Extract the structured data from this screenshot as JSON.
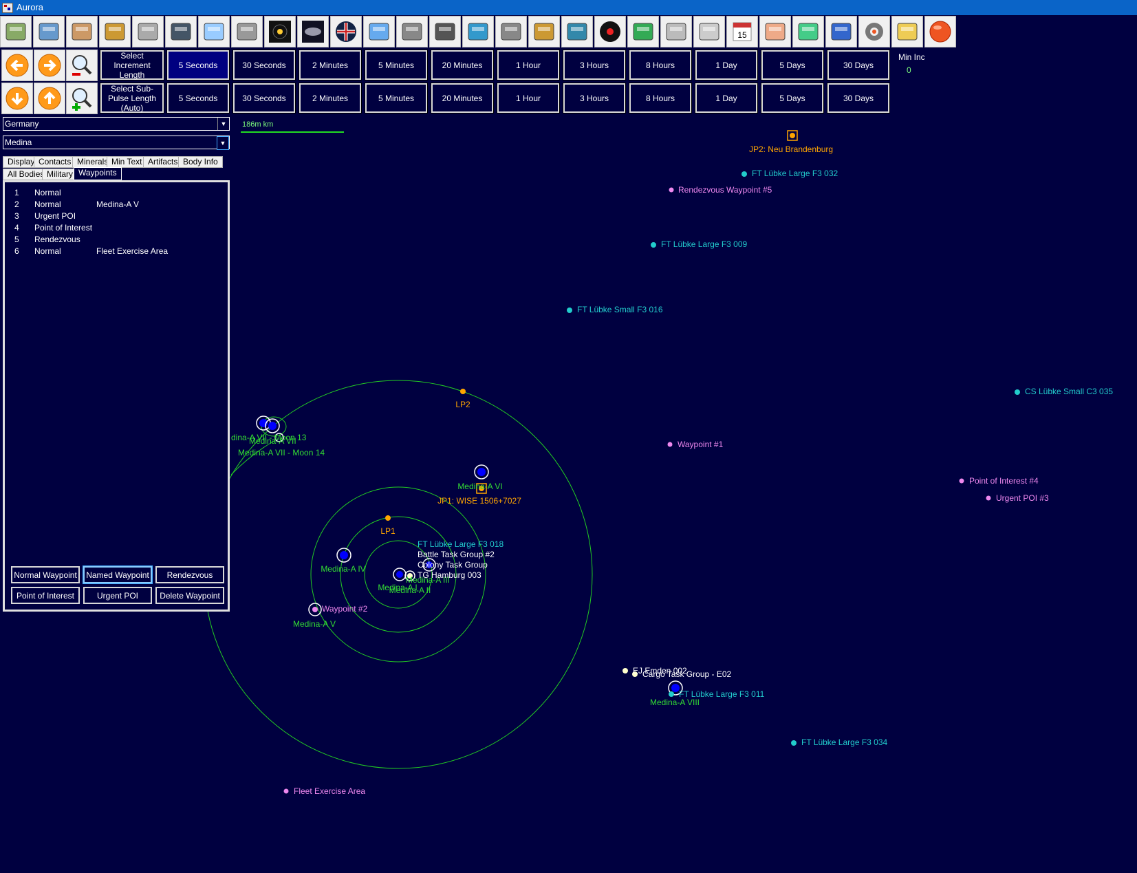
{
  "window": {
    "title": "Aurora"
  },
  "toolbar_icons": [
    "home-icon",
    "colony-buildings-icon",
    "industry-worker-icon",
    "economy-money-bag-icon",
    "ground-forces-mech-icon",
    "commander-officer-icon",
    "ship-design-blueprint-icon",
    "starship-icon",
    "system-view-icon",
    "galaxy-map-icon",
    "race-flag-icon",
    "event-log-icon",
    "missile-design-icon",
    "turret-design-icon",
    "planet-globe-icon",
    "research-database-icon",
    "technology-icon",
    "sensor-map-icon",
    "intelligence-eye-icon",
    "circuit-board-icon",
    "cargo-icon",
    "government-building-icon",
    "calendar-icon",
    "alien-race-icon",
    "refresh-cycle-icon",
    "save-disk-icon",
    "settings-gear-icon",
    "light-bulb-icon",
    "red-end-turn-icon"
  ],
  "time_controls": {
    "increment_label": "Select Increment Length",
    "subpulse_label": "Select Sub-Pulse Length (Auto)",
    "increments": [
      "5 Seconds",
      "30 Seconds",
      "2 Minutes",
      "5 Minutes",
      "20 Minutes",
      "1 Hour",
      "3 Hours",
      "8 Hours",
      "1 Day",
      "5 Days",
      "30 Days"
    ],
    "selected_increment": "5 Seconds",
    "min_inc_label": "Min Inc",
    "min_inc_value": "0"
  },
  "selectors": {
    "race": "Germany",
    "system": "Medina"
  },
  "tabs": {
    "row1": [
      "Display",
      "Contacts",
      "Minerals",
      "Min Text",
      "Artifacts",
      "Body Info"
    ],
    "row2": [
      "All Bodies",
      "Military",
      "Waypoints"
    ],
    "active": "Waypoints"
  },
  "waypoints": [
    {
      "num": "1",
      "type": "Normal",
      "name": ""
    },
    {
      "num": "2",
      "type": "Normal",
      "name": "Medina-A V"
    },
    {
      "num": "3",
      "type": "Urgent POI",
      "name": ""
    },
    {
      "num": "4",
      "type": "Point of Interest",
      "name": ""
    },
    {
      "num": "5",
      "type": "Rendezvous",
      "name": ""
    },
    {
      "num": "6",
      "type": "Normal",
      "name": "Fleet Exercise Area"
    }
  ],
  "waypoint_buttons": {
    "normal": "Normal Waypoint",
    "named": "Named Waypoint",
    "rendezvous": "Rendezvous",
    "poi": "Point of Interest",
    "urgent": "Urgent POI",
    "delete": "Delete Waypoint"
  },
  "map": {
    "scale_label": "186m km",
    "colors": {
      "background": "#000040",
      "orbit": "#22cc22",
      "body_label": "#33dd33",
      "contact": "#22cccc",
      "waypoint": "#ee88ee",
      "jump_point": "#ffa500",
      "fleet": "#ffffcc"
    },
    "labels": {
      "jp2": "JP2: Neu Brandenburg",
      "jp1": "JP1: WISE 1506+7027",
      "lp1": "LP1",
      "lp2": "LP2",
      "ft032": "FT Lübke Large F3 032",
      "ft009": "FT Lübke Large F3 009",
      "ft016": "FT Lübke Small F3 016",
      "cs035": "CS Lübke Small C3 035",
      "ft018": "FT Lübke Large F3 018",
      "ft011": "FT Lübke Large F3 011",
      "ft034": "FT Lübke Large F3 034",
      "wp5": "Rendezvous Waypoint #5",
      "wp1": "Waypoint #1",
      "wp4": "Point of Interest #4",
      "wp3": "Urgent POI #3",
      "wp2": "Waypoint #2",
      "wp6": "Fleet Exercise Area",
      "medina_a_vi": "Medina-A VI",
      "medina_a_iv": "Medina-A IV",
      "medina_a_v": "Medina-A V",
      "medina_a_viii": "Medina-A VIII",
      "medina_a_iii": "Medina-A III",
      "medina_a_ii": "Medina-A II",
      "medina_a_i": "Medina-A I",
      "moon13": "dina-A VII - Moon 13",
      "medina_a_vii": "Medina-A VII",
      "moon14": "Medina-A VII - Moon 14",
      "battle_tg2": "Battle Task Group #2",
      "colony_tg": "Colony Task Group",
      "tg_hamburg": "TG Hamburg 003",
      "ej_emden": "EJ Emden 002",
      "cargo_tg": "Cargo Task Group - E02"
    }
  }
}
